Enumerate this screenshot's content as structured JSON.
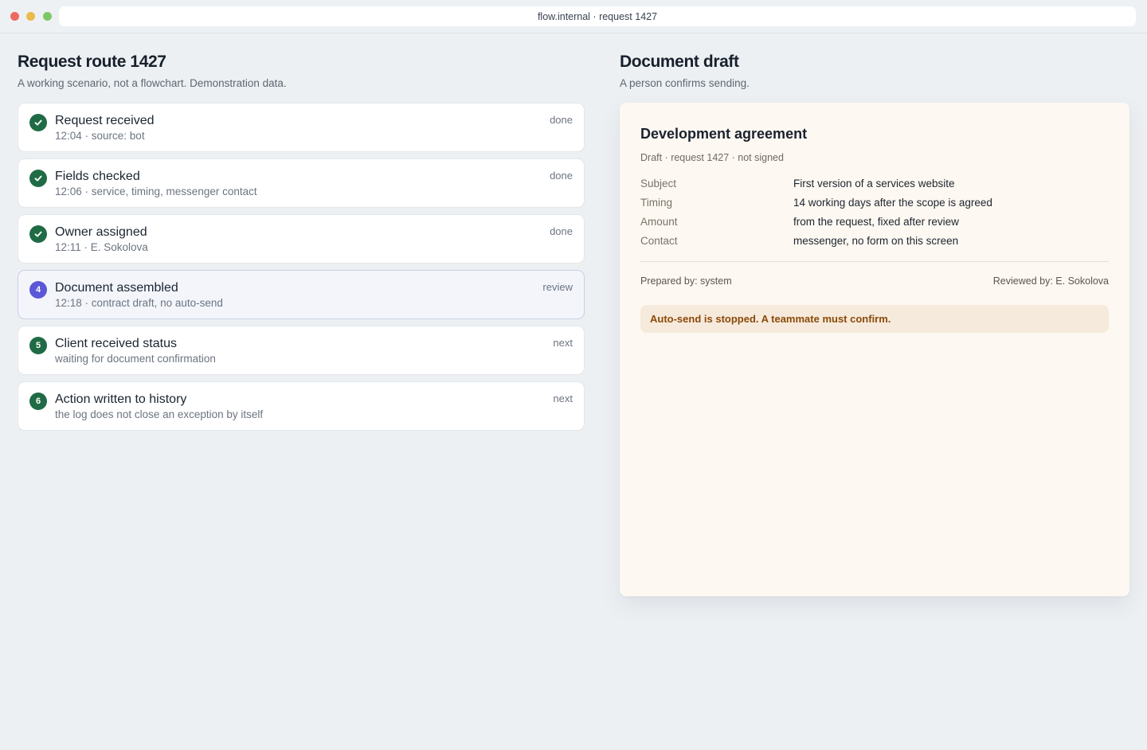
{
  "browser": {
    "url": "flow.internal · request 1427"
  },
  "route": {
    "title": "Request route 1427",
    "subtitle": "A working scenario, not a flowchart. Demonstration data.",
    "steps": [
      {
        "marker": "check",
        "title": "Request received",
        "meta": "12:04 · source: bot",
        "status": "done"
      },
      {
        "marker": "check",
        "title": "Fields checked",
        "meta": "12:06 · service, timing, messenger contact",
        "status": "done"
      },
      {
        "marker": "check",
        "title": "Owner assigned",
        "meta": "12:11 · E. Sokolova",
        "status": "done"
      },
      {
        "marker": "4",
        "title": "Document assembled",
        "meta": "12:18 · contract draft, no auto-send",
        "status": "review"
      },
      {
        "marker": "5",
        "title": "Client received status",
        "meta": "waiting for document confirmation",
        "status": "next"
      },
      {
        "marker": "6",
        "title": "Action written to history",
        "meta": "the log does not close an exception by itself",
        "status": "next"
      }
    ]
  },
  "draft": {
    "title": "Document draft",
    "subtitle": "A person confirms sending.",
    "document": {
      "title": "Development agreement",
      "status": "Draft · request 1427 · not signed",
      "fields": [
        {
          "label": "Subject",
          "value": "First version of a services website"
        },
        {
          "label": "Timing",
          "value": "14 working days after the scope is agreed"
        },
        {
          "label": "Amount",
          "value": "from the request, fixed after review"
        },
        {
          "label": "Contact",
          "value": "messenger, no form on this screen"
        }
      ],
      "prepared_by": "Prepared by: system",
      "reviewed_by": "Reviewed by: E. Sokolova",
      "alert": "Auto-send is stopped. A teammate must confirm."
    }
  },
  "colors": {
    "done_badge": "#1f6b45",
    "active_badge": "#5b57d6",
    "alert_text": "#8a4a08",
    "alert_bg": "#f6eadc",
    "card_bg": "#fdf8f1"
  }
}
